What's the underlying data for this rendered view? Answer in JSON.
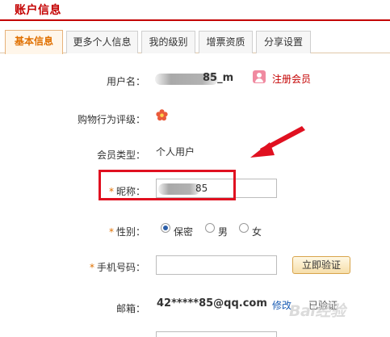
{
  "header": {
    "title": "账户信息"
  },
  "tabs": [
    {
      "label": "基本信息",
      "active": true
    },
    {
      "label": "更多个人信息",
      "active": false
    },
    {
      "label": "我的级别",
      "active": false
    },
    {
      "label": "增票资质",
      "active": false
    },
    {
      "label": "分享设置",
      "active": false
    }
  ],
  "form": {
    "username": {
      "label": "用户名：",
      "value_suffix": "85_m",
      "badge": "注册会员"
    },
    "rating": {
      "label": "购物行为评级：",
      "icon": "flower-icon"
    },
    "member_type": {
      "label": "会员类型：",
      "value": "个人用户"
    },
    "nickname": {
      "required_mark": "*",
      "label": "昵称：",
      "value_suffix": "85"
    },
    "gender": {
      "required_mark": "*",
      "label": "性别：",
      "options": [
        "保密",
        "男",
        "女"
      ],
      "selected": "保密"
    },
    "phone": {
      "required_mark": "*",
      "label": "手机号码：",
      "value": "",
      "verify_label": "立即验证"
    },
    "email": {
      "label": "邮箱：",
      "value": "42*****85@qq.com",
      "edit_label": "修改",
      "status": "已验证"
    }
  },
  "watermark": {
    "text": "Bai经验"
  },
  "colors": {
    "accent": "#c40000",
    "tab_active": "#e07000",
    "link": "#1a5cb4",
    "annotation": "#e01020"
  }
}
